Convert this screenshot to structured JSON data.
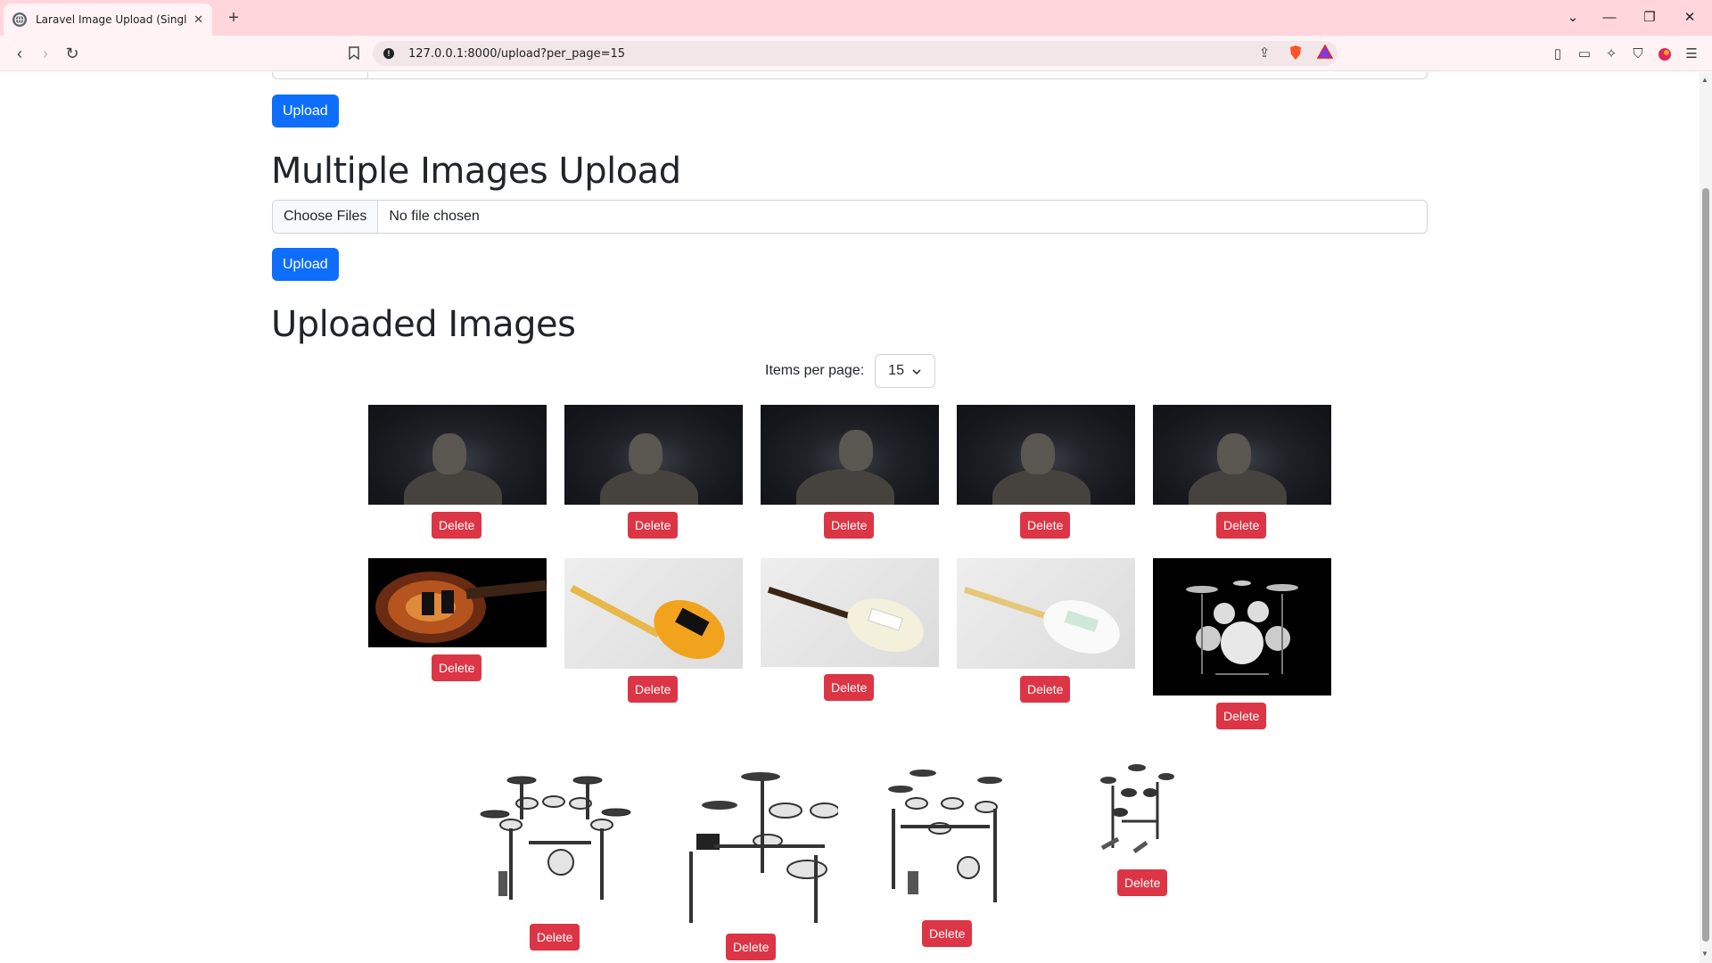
{
  "browser": {
    "tab_title": "Laravel Image Upload (Single + ",
    "url": "127.0.0.1:8000/upload?per_page=15"
  },
  "page": {
    "single_upload_button": "Upload",
    "multiple_heading": "Multiple Images Upload",
    "file_input": {
      "button_label": "Choose Files",
      "status": "No file chosen"
    },
    "multiple_upload_button": "Upload",
    "uploaded_heading": "Uploaded Images",
    "per_page": {
      "label": "Items per page:",
      "selected": "15"
    },
    "delete_label": "Delete",
    "images": [
      {
        "kind": "dark-portrait"
      },
      {
        "kind": "dark-portrait"
      },
      {
        "kind": "dark-portrait"
      },
      {
        "kind": "dark-portrait"
      },
      {
        "kind": "dark-portrait"
      },
      {
        "kind": "sunburst-guitar"
      },
      {
        "kind": "yellow-telecaster"
      },
      {
        "kind": "white-stratocaster"
      },
      {
        "kind": "white-stratocaster"
      },
      {
        "kind": "drum-kit-on-black"
      },
      {
        "kind": "electronic-drum-kit"
      },
      {
        "kind": "electronic-drum-kit"
      },
      {
        "kind": "electronic-drum-kit"
      },
      {
        "kind": "electronic-drum-kit"
      }
    ]
  },
  "colors": {
    "primary": "#0d6efd",
    "danger": "#dc3545",
    "tab_bar": "#ffd6dc"
  }
}
